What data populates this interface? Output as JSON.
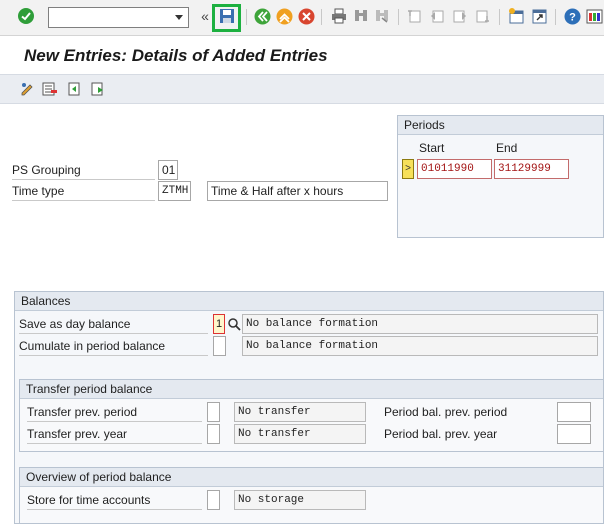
{
  "toolbar": {
    "command_field_value": "",
    "icons": [
      "enter-icon",
      "save-icon",
      "back-icon",
      "exit-icon",
      "cancel-icon",
      "print-icon",
      "find-icon",
      "find-next-icon",
      "first-page-icon",
      "previous-page-icon",
      "next-page-icon",
      "last-page-icon",
      "new-session-icon",
      "shortcut-icon",
      "help-icon",
      "customize-layout-icon"
    ],
    "double_chevron": "«"
  },
  "title": "New Entries: Details of Added Entries",
  "app_toolbar": {
    "icons": [
      "change-icon",
      "delete-icon",
      "undo-icon",
      "next-entry-icon"
    ]
  },
  "form": {
    "ps_grouping_label": "PS Grouping",
    "ps_grouping_value": "01",
    "time_type_label": "Time type",
    "time_type_value": "ZTMH",
    "time_type_text": "Time & Half after x hours"
  },
  "periods": {
    "title": "Periods",
    "start_label": "Start",
    "end_label": "End",
    "select_symbol": ">",
    "start_value": "01011990",
    "end_value": "31129999"
  },
  "balances": {
    "title": "Balances",
    "save_day_label": "Save as day balance",
    "save_day_value": "1",
    "save_day_text": "No balance formation",
    "cumulate_label": "Cumulate in period balance",
    "cumulate_value": "",
    "cumulate_text": "No balance formation"
  },
  "transfer": {
    "title": "Transfer period balance",
    "prev_period_label": "Transfer prev. period",
    "prev_period_value": "",
    "prev_period_text": "No transfer",
    "prev_year_label": "Transfer prev. year",
    "prev_year_value": "",
    "prev_year_text": "No transfer",
    "bal_prev_period_label": "Period bal. prev. period",
    "bal_prev_period_value": "",
    "bal_prev_year_label": "Period bal. prev. year",
    "bal_prev_year_value": ""
  },
  "overview": {
    "title": "Overview of period balance",
    "store_label": "Store for time accounts",
    "store_value": "",
    "store_text": "No storage"
  },
  "colors": {
    "save_highlight": "#1db040",
    "group_border": "#b8c3d1",
    "period_value_text": "#a31414"
  }
}
